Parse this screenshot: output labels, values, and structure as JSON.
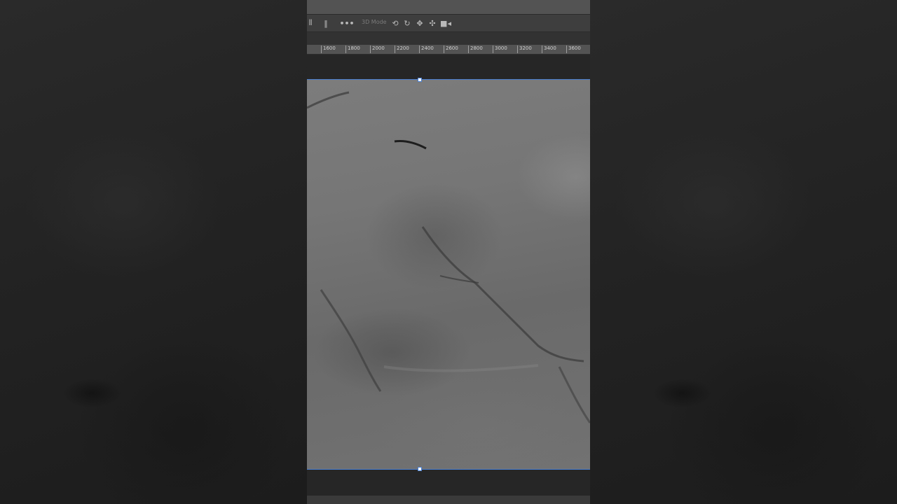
{
  "app": {
    "options_bar": {
      "mode_label": "3D Mode",
      "icons": [
        "align-icon",
        "distribute-icon",
        "more-icon",
        "orbit-icon",
        "roll-icon",
        "pan-icon",
        "slide-icon",
        "scale-icon"
      ]
    },
    "ruler": {
      "ticks": [
        "1600",
        "1800",
        "2000",
        "2200",
        "2400",
        "2600",
        "2800",
        "3000",
        "3200",
        "3400",
        "3600"
      ]
    },
    "canvas": {
      "image_name": "stone texture",
      "selection_color": "#4a7fd0"
    }
  },
  "colors": {
    "background": "#1f1f1f",
    "panel": "#3e3e3e",
    "ruler": "#535353",
    "accent": "#4a7fd0"
  }
}
